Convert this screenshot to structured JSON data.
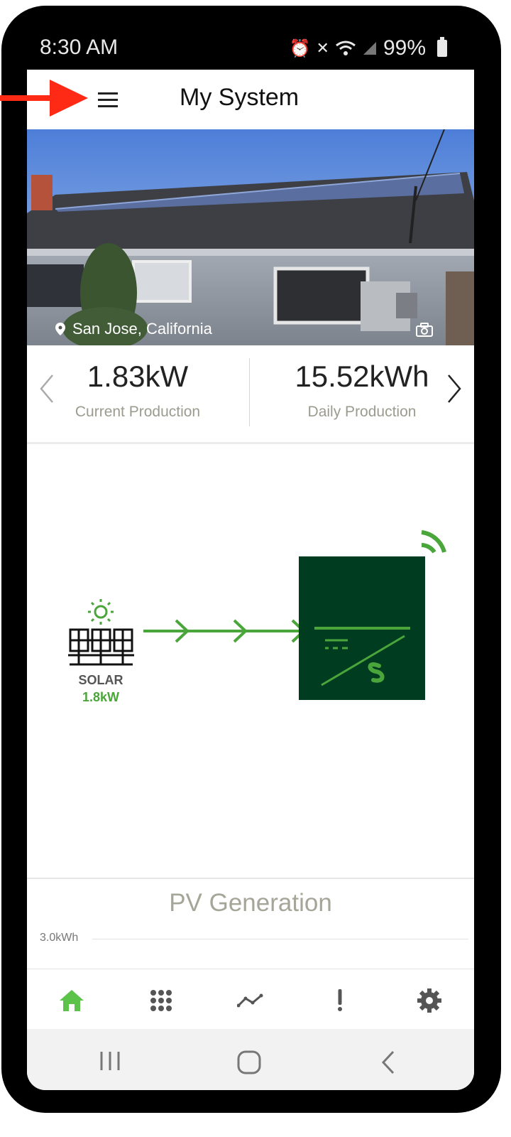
{
  "status_bar": {
    "time": "8:30 AM",
    "battery": "99%"
  },
  "app_bar": {
    "title": "My System"
  },
  "hero": {
    "location": "San Jose, California"
  },
  "stats": {
    "current_value": "1.83kW",
    "current_label": "Current Production",
    "daily_value": "15.52kWh",
    "daily_label": "Daily Production"
  },
  "flow": {
    "solar_label": "SOLAR",
    "solar_value": "1.8kW"
  },
  "pv_chart": {
    "title": "PV Generation",
    "axis_label": "3.0kWh"
  },
  "colors": {
    "accent_green": "#4aa53a",
    "inverter_green": "#003d20",
    "annotation_red": "#ff2a16"
  },
  "icons": {
    "nav": [
      "home-icon",
      "apps-grid-icon",
      "trend-icon",
      "alert-icon",
      "gear-icon"
    ],
    "system": [
      "recent-apps-icon",
      "home-button-icon",
      "back-icon"
    ]
  }
}
